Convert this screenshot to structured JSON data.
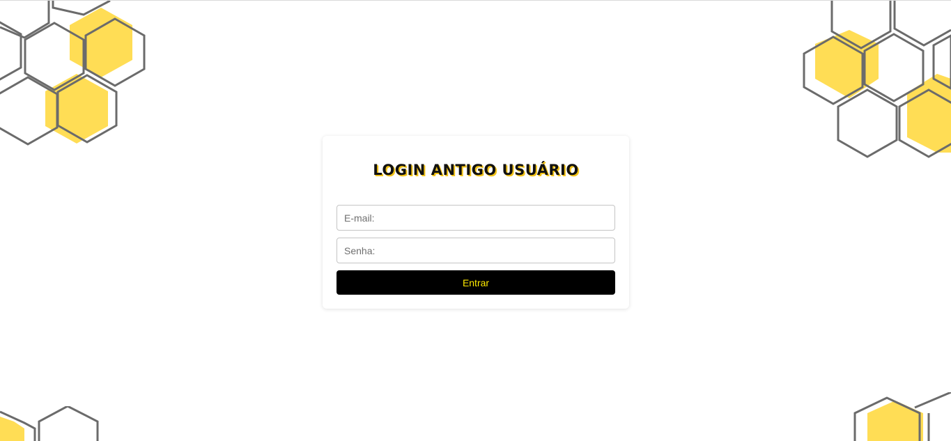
{
  "login": {
    "title": "Login Antigo Usuário",
    "email_placeholder": "E-mail:",
    "email_value": "",
    "password_placeholder": "Senha:",
    "password_value": "",
    "submit_label": "Entrar"
  },
  "colors": {
    "accent_yellow": "#FFDD55",
    "hex_outline": "#6b6b6b",
    "button_bg": "#000000",
    "button_text": "#FFEA00"
  }
}
